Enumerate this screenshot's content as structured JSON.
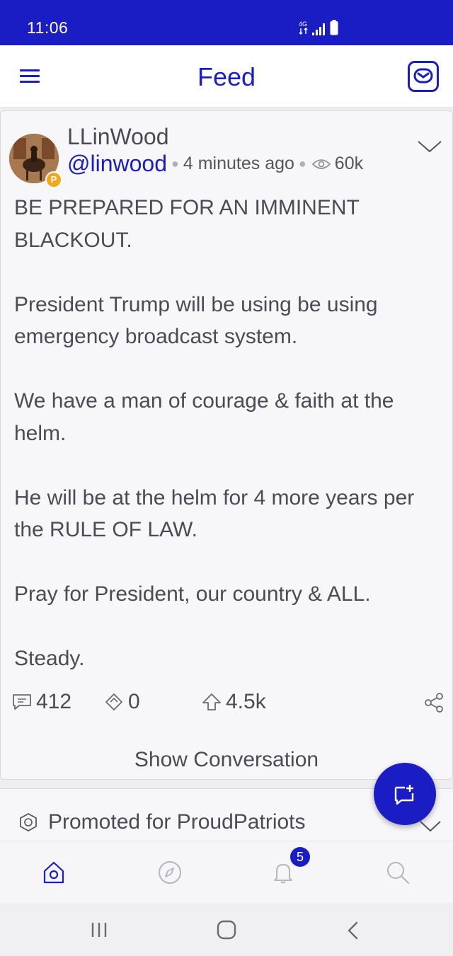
{
  "status_bar": {
    "time": "11:06",
    "icons": [
      "data-transfer-icon",
      "signal-icon",
      "battery-icon"
    ],
    "color": "#1a1dc4"
  },
  "app_bar": {
    "title": "Feed",
    "menu_icon": "hamburger-menu-icon",
    "mail_icon": "mail-icon"
  },
  "post": {
    "display_name": "LLinWood",
    "handle": "@linwood",
    "time_ago": "4 minutes ago",
    "views": "60k",
    "paragraphs": [
      "BE PREPARED FOR AN IMMINENT BLACKOUT.",
      "President Trump will be using be using emergency broadcast system.",
      "We have a man of courage & faith at the helm.",
      "He will be at the helm for 4 more years per the RULE OF LAW.",
      "Pray for President, our country & ALL.",
      "Steady."
    ],
    "actions": {
      "comments": "412",
      "echoes": "0",
      "upvotes": "4.5k"
    },
    "show_conversation": "Show Conversation"
  },
  "promo": {
    "label": "Promoted for ProudPatriots"
  },
  "bottom_nav": {
    "items": [
      "home-icon",
      "discover-icon",
      "notifications-icon",
      "search-icon"
    ],
    "notification_count": "5"
  },
  "system_nav": [
    "recent-apps-icon",
    "home-button-icon",
    "back-icon"
  ]
}
